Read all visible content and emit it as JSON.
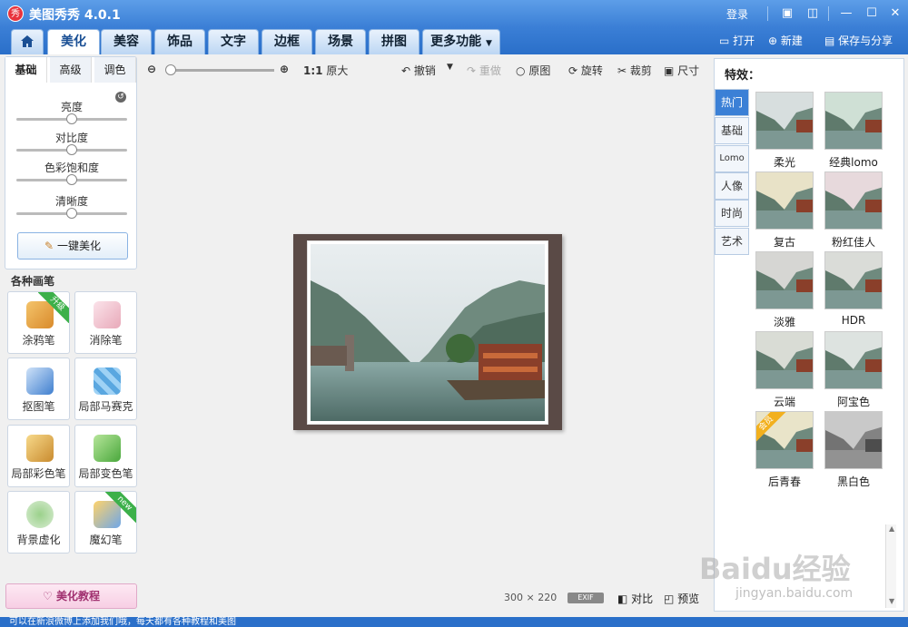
{
  "app": {
    "title": "美图秀秀 4.0.1",
    "logo_text": "秀"
  },
  "titlebar": {
    "login": "登录"
  },
  "tabs": [
    "美化",
    "美容",
    "饰品",
    "文字",
    "边框",
    "场景",
    "拼图",
    "更多功能"
  ],
  "actions": {
    "open": "打开",
    "new": "新建",
    "save_share": "保存与分享"
  },
  "subtabs": [
    "基础",
    "高级",
    "调色"
  ],
  "sliders": [
    {
      "label": "亮度",
      "value": 0.5
    },
    {
      "label": "对比度",
      "value": 0.5
    },
    {
      "label": "色彩饱和度",
      "value": 0.5
    },
    {
      "label": "清晰度",
      "value": 0.5
    }
  ],
  "onekey": "一键美化",
  "brushes_title": "各种画笔",
  "brushes": [
    {
      "label": "涂鸦笔",
      "badge": "升级"
    },
    {
      "label": "消除笔",
      "badge": ""
    },
    {
      "label": "抠图笔",
      "badge": ""
    },
    {
      "label": "局部马赛克",
      "badge": ""
    },
    {
      "label": "局部彩色笔",
      "badge": ""
    },
    {
      "label": "局部变色笔",
      "badge": ""
    },
    {
      "label": "背景虚化",
      "badge": ""
    },
    {
      "label": "魔幻笔",
      "badge": "new"
    }
  ],
  "tutorial": "美化教程",
  "toolbar": {
    "zoom_ratio": "1:1",
    "original_size": "原大",
    "undo": "撤销",
    "redo": "重做",
    "original": "原图",
    "rotate": "旋转",
    "crop": "裁剪",
    "resize": "尺寸"
  },
  "status": {
    "width": "300",
    "x": "×",
    "height": "220",
    "exif": "EXIF",
    "compare": "对比",
    "preview": "预览"
  },
  "effects": {
    "title": "特效：",
    "categories": [
      "热门",
      "基础",
      "Lomo",
      "人像",
      "时尚",
      "艺术"
    ],
    "items": [
      {
        "label": "柔光",
        "badge": ""
      },
      {
        "label": "经典lomo",
        "badge": ""
      },
      {
        "label": "复古",
        "badge": ""
      },
      {
        "label": "粉红佳人",
        "badge": ""
      },
      {
        "label": "淡雅",
        "badge": ""
      },
      {
        "label": "HDR",
        "badge": ""
      },
      {
        "label": "云端",
        "badge": ""
      },
      {
        "label": "阿宝色",
        "badge": ""
      },
      {
        "label": "后青春",
        "badge": "会员"
      },
      {
        "label": "黑白色",
        "badge": ""
      }
    ]
  },
  "watermark": {
    "brand": "Baidu经验",
    "url": "jingyan.baidu.com"
  },
  "statusbar": "可以在新浪微博上添加我们哦，每天都有各种教程和美图"
}
